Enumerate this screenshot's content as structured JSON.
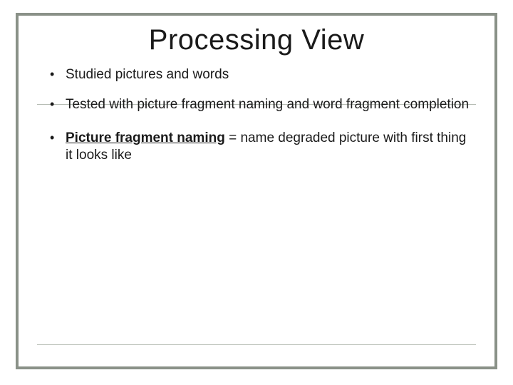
{
  "slide": {
    "title": "Processing View",
    "bullets": [
      {
        "text": "Studied pictures and words"
      },
      {
        "text": "Tested with picture fragment naming and word fragment completion"
      },
      {
        "term": "Picture fragment naming",
        "rest": " = name degraded picture with first thing it looks like"
      }
    ]
  }
}
